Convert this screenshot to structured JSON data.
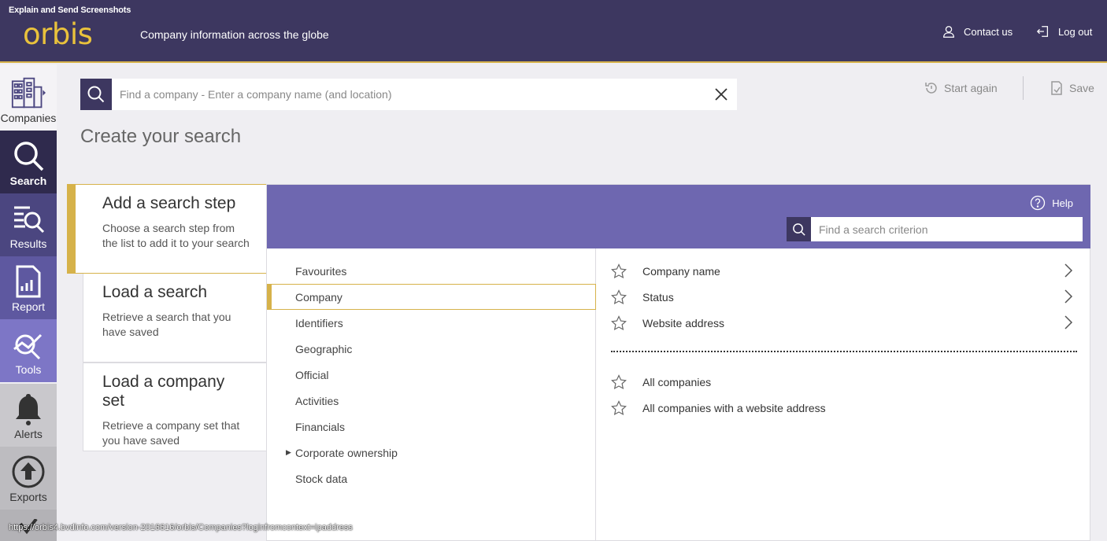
{
  "overlay_title": "Explain and Send Screenshots",
  "header": {
    "logo": "orbis",
    "tagline": "Company information across the globe",
    "contact_label": "Contact us",
    "logout_label": "Log out"
  },
  "rail": {
    "companies": "Companies",
    "search": "Search",
    "results": "Results",
    "report": "Report",
    "tools": "Tools",
    "alerts": "Alerts",
    "exports": "Exports"
  },
  "search": {
    "placeholder": "Find a company - Enter a company name (and location)"
  },
  "actions": {
    "start_again": "Start again",
    "save": "Save"
  },
  "page_title": "Create your search",
  "steps": [
    {
      "title": "Add a search step",
      "desc": "Choose a search step from the list to add it to your search"
    },
    {
      "title": "Load a search",
      "desc": "Retrieve a search that you have saved"
    },
    {
      "title": "Load a company set",
      "desc": "Retrieve a company set that you have saved"
    }
  ],
  "panel": {
    "help_label": "Help",
    "criterion_placeholder": "Find a search criterion"
  },
  "categories": [
    "Favourites",
    "Company",
    "Identifiers",
    "Geographic",
    "Official",
    "Activities",
    "Financials",
    "Corporate ownership",
    "Stock data"
  ],
  "selected_category": "Company",
  "criteria": [
    "Company name",
    "Status",
    "Website address"
  ],
  "presets": [
    "All companies",
    "All companies with a website address"
  ],
  "status_url": "https://orbis4.bvdinfo.com/version-2016616/orbis/Companies?loginfromcontext=ipaddress",
  "colors": {
    "header_bg": "#3d3760",
    "accent_gold": "#d6b24a",
    "panel_header": "#6e67b0"
  }
}
